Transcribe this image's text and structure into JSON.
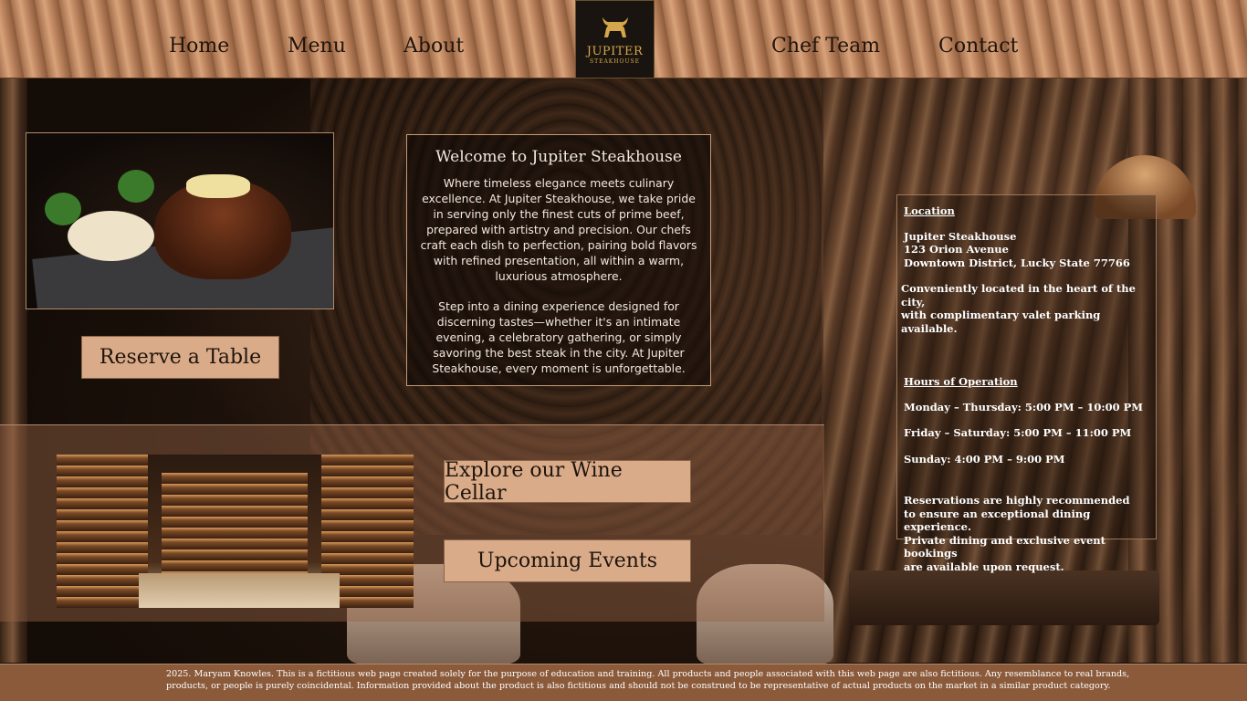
{
  "nav": {
    "home": "Home",
    "menu": "Menu",
    "about": "About",
    "chef_team": "Chef Team",
    "contact": "Contact"
  },
  "logo": {
    "name": "JUPITER",
    "sub": "STEAKHOUSE",
    "icon": "bull-icon"
  },
  "buttons": {
    "reserve": "Reserve a Table",
    "wine": "Explore our Wine Cellar",
    "events": "Upcoming Events"
  },
  "welcome": {
    "title": "Welcome to Jupiter Steakhouse",
    "p1": "Where timeless elegance meets culinary excellence. At Jupiter Steakhouse, we take pride in serving only the finest cuts of prime beef, prepared with artistry and precision. Our chefs craft each dish to perfection, pairing bold flavors with refined presentation, all within a warm, luxurious atmosphere.",
    "p2": "Step into a dining experience designed for discerning tastes—whether it's an intimate evening, a celebratory gathering, or simply savoring the best steak in the city. At Jupiter Steakhouse, every moment is unforgettable."
  },
  "info": {
    "location_heading": "Location",
    "address_name": "Jupiter Steakhouse",
    "address_street": "123 Orion Avenue",
    "address_city": "Downtown District, Lucky State 77766",
    "location_note_1": "Conveniently located in the heart of the city,",
    "location_note_2": "with complimentary valet parking available.",
    "hours_heading": "Hours of Operation",
    "hours_1": "Monday – Thursday: 5:00 PM – 10:00 PM",
    "hours_2": "Friday – Saturday: 5:00 PM – 11:00 PM",
    "hours_3": "Sunday: 4:00 PM – 9:00 PM",
    "res_1": "Reservations are highly recommended",
    "res_2": "to ensure an exceptional dining experience.",
    "res_3": "Private dining and exclusive event bookings",
    "res_4": "are available upon request."
  },
  "footer": {
    "line1": "2025. Maryam Knowles. This is a fictitious web page created solely for the purpose of education and training. All products and people associated with this web page are also fictitious. Any resemblance to real brands,",
    "line2": "products, or people is purely coincidental. Information provided about the product is also fictitious and should not be construed to be representative of actual products on the market in a similar product category."
  },
  "colors": {
    "header": "#c58f68",
    "button": "#d9ab89",
    "footer": "#8a5a3a",
    "logo_gold": "#d4a84a"
  }
}
